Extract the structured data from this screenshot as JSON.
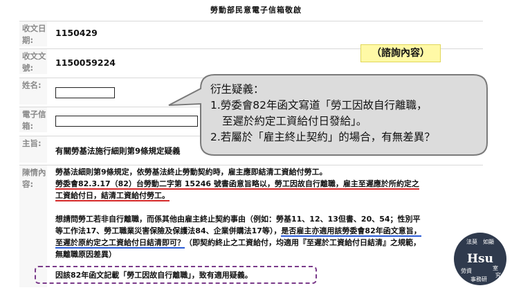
{
  "title": "勞動部民意電子信箱敬啟",
  "fields": {
    "received_date": {
      "label": "收文日期:",
      "value": "1150429"
    },
    "doc_no": {
      "label": "收文文號:",
      "value": "1150059224"
    },
    "name": {
      "label": "姓名:"
    },
    "email": {
      "label": "電子信箱:"
    },
    "subject": {
      "label": "主旨:",
      "value": "有關勞基法施行細則第9條規定疑義"
    },
    "content_label": "陳情內容:"
  },
  "tag": "（諮詢內容）",
  "bubble": {
    "heading": "衍生疑義：",
    "line1": "1.勞委會82年函文寫道「勞工因故自行離職，",
    "line2": "至遲於約定工資給付日發給」。",
    "line3": "2.若屬於「雇主終止契約」的場合，有無差異？"
  },
  "content": {
    "p1_l1": "勞基法細則第9條規定，依勞基法終止勞動契約時，雇主應即結清工資給付勞工。",
    "p1_l2": "勞委會82.3.17（82）台勞動二字第 15246 號書函意旨略以，勞工因故自行離職，雇主至遲應於所約定之",
    "p1_l3": "工資給付日，結清工資給付勞工。",
    "p2_l1": "想請問勞工若非自行離職，而係其他由雇主終止契約事由（例如：勞基11、12、13但書、20、54；性別平",
    "p2_l2a": "等工作法17、勞工職業災害保險及保護法84、企業併購法17等），",
    "p2_l2b": "是否雇主亦適用該勞委會82年函文意旨，",
    "p2_l3a": "至遲於原約定之工資給付日結清即可？",
    "p2_l3b": "（即契約終止之工資給付，均適用『至遲於工資給付日結清』之規範，",
    "p2_l4": "無離職原因差異）",
    "p3": "因該82年函文記載「勞工因故自行離職」，致有適用疑義。"
  },
  "logo": {
    "main": "Hsu",
    "top_left": "法莫",
    "top_right": "如顯",
    "bottom_left": "勞資",
    "bottom_right": "室",
    "bottom_right2": "究",
    "bottom": "事務研"
  },
  "colors": {
    "red_underline": "#d62a2a",
    "blue_underline": "#2a5bd6",
    "dash_box": "#7a3a8a",
    "tag_bg": "#fff9a6"
  }
}
